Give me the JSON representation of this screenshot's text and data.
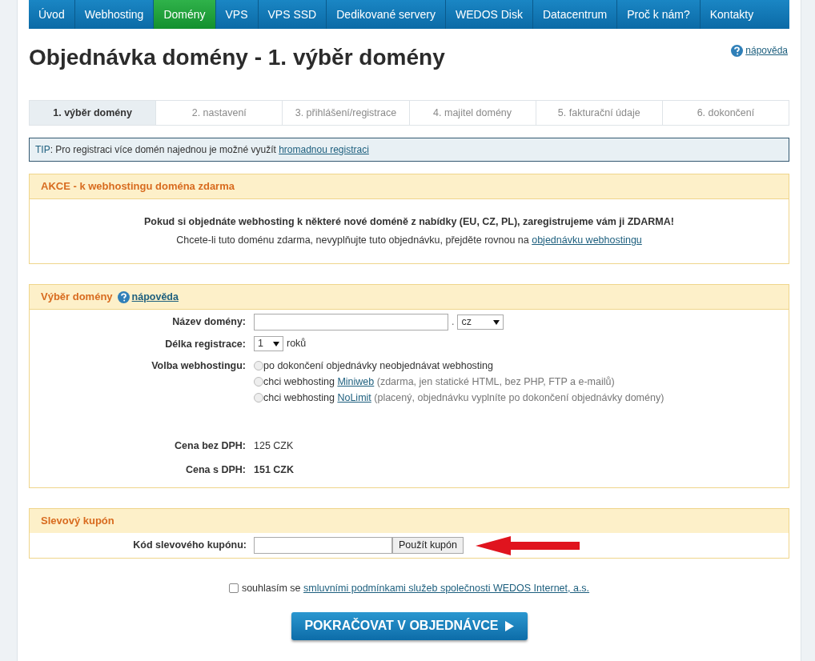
{
  "nav": [
    {
      "label": "Úvod",
      "selected": false
    },
    {
      "label": "Webhosting",
      "selected": false
    },
    {
      "label": "Domény",
      "selected": true
    },
    {
      "label": "VPS",
      "selected": false
    },
    {
      "label": "VPS SSD",
      "selected": false
    },
    {
      "label": "Dedikované servery",
      "selected": false
    },
    {
      "label": "WEDOS Disk",
      "selected": false
    },
    {
      "label": "Datacentrum",
      "selected": false
    },
    {
      "label": "Proč k nám?",
      "selected": false
    },
    {
      "label": "Kontakty",
      "selected": false
    }
  ],
  "title": "Objednávka domény - 1. výběr domény",
  "help_link": "nápověda",
  "steps": [
    {
      "label": "1. výběr domény",
      "selected": true
    },
    {
      "label": "2. nastavení",
      "selected": false
    },
    {
      "label": "3. přihlášení/registrace",
      "selected": false
    },
    {
      "label": "4. majitel domény",
      "selected": false
    },
    {
      "label": "5. fakturační údaje",
      "selected": false
    },
    {
      "label": "6. dokončení",
      "selected": false
    }
  ],
  "tip": {
    "label": "TIP",
    "text": ": Pro registraci více domén najednou je možné využít ",
    "link": "hromadnou registraci"
  },
  "promo": {
    "heading": "AKCE - k webhostingu doména zdarma",
    "line_1": "Pokud si objednáte webhosting k některé nové doméně z nabídky (EU, CZ, PL), zaregistrujeme vám ji ZDARMA!",
    "line_2": "Chcete-li tuto doménu zdarma, nevyplňujte tuto objednávku, přejděte rovnou na ",
    "line_2_link": "objednávku webhostingu"
  },
  "domain_section": {
    "heading": "Výběr domény",
    "help_link": "nápověda",
    "domain_label": "Název domény:",
    "domain_separator": ".",
    "tld": "cz",
    "length_label": "Délka registrace:",
    "length": "1",
    "length_unit": "roků",
    "hosting_label": "Volba webhostingu:",
    "hosting_options": [
      {
        "text": "po dokončení objednávky neobjednávat webhosting",
        "selected": false
      },
      {
        "text": "chci webhosting ",
        "link": "Miniweb",
        "note": " (zdarma, jen statické HTML, bez PHP, FTP a e-mailů)",
        "selected": false
      },
      {
        "text": "chci webhosting ",
        "link": "NoLimit",
        "note": " (placený, objednávku vyplníte po dokončení objednávky domény)",
        "selected": false
      }
    ],
    "prices": [
      {
        "label": "Cena bez DPH:",
        "value": "125 CZK",
        "bold": false
      },
      {
        "label": "Cena s DPH:",
        "value": "151 CZK",
        "bold": true
      }
    ]
  },
  "coupon": {
    "heading": "Slevový kupón",
    "label": "Kód slevového kupónu:",
    "button": "Použít kupón"
  },
  "agree": {
    "checked": false,
    "text": "souhlasím se ",
    "link": "smluvními podmínkami služeb společnosti WEDOS Internet, a.s."
  },
  "continue_button": "POKRAČOVAT V OBJEDNÁVCE"
}
